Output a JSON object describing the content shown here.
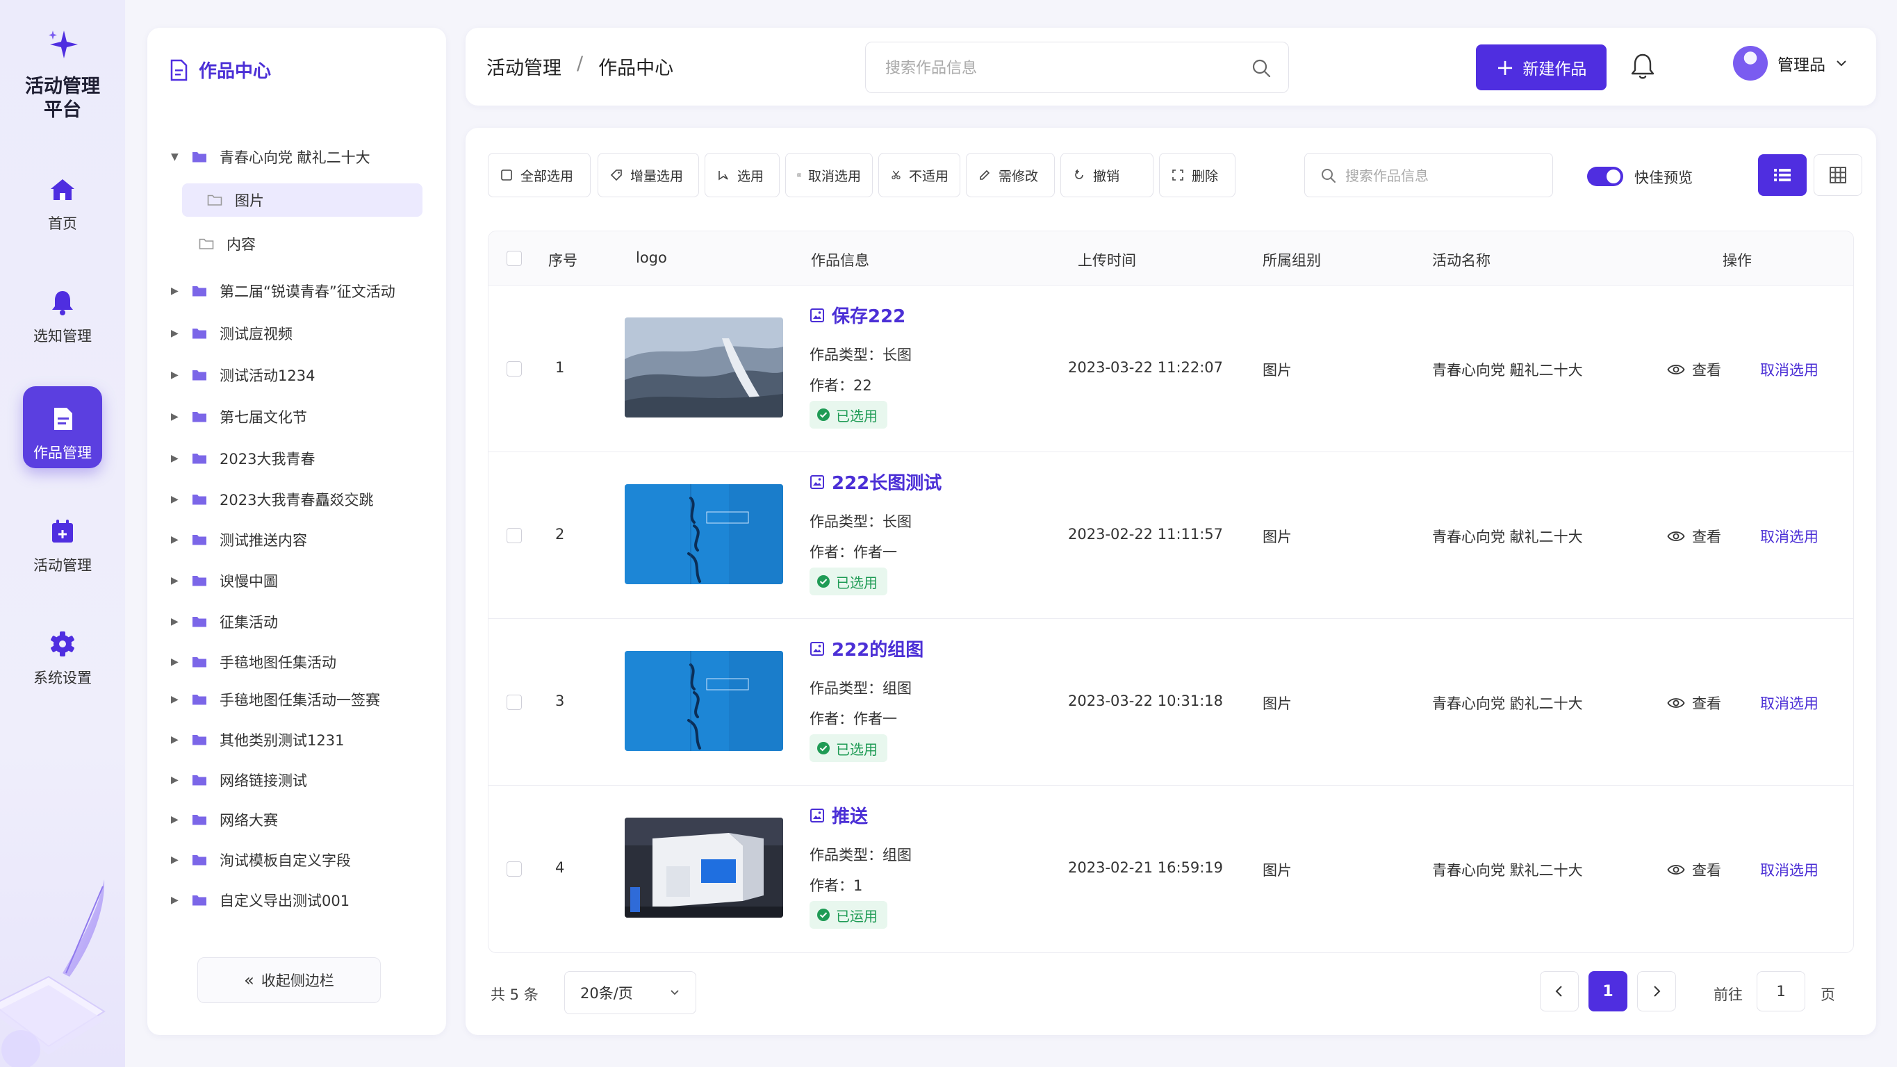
{
  "app": {
    "title": "活动管理\n平台"
  },
  "colors": {
    "primary": "#4f2ee0",
    "selected_green": "#1f9b55",
    "link": "#4b2fd6"
  },
  "nav": {
    "items": [
      {
        "label": "首页",
        "icon": "home-icon"
      },
      {
        "label": "选知管理",
        "icon": "bell-icon"
      },
      {
        "label": "作品管理",
        "icon": "document-icon",
        "active": true
      },
      {
        "label": "活动管理",
        "icon": "calendar-icon"
      },
      {
        "label": "系统设置",
        "icon": "gear-icon"
      }
    ]
  },
  "tree": {
    "title": "作品中心",
    "items": [
      {
        "label": "青春心向党 献礼二十大",
        "expanded": true
      },
      {
        "label": "图片",
        "child": true,
        "selected": true
      },
      {
        "label": "内容",
        "child": true
      },
      {
        "label": "第二届“锐谟青春”征文活动"
      },
      {
        "label": "测试㢄视频"
      },
      {
        "label": "测试活动1234"
      },
      {
        "label": "第七届文化节"
      },
      {
        "label": "2023大我青春"
      },
      {
        "label": "2023大我青春矗㸚交跳"
      },
      {
        "label": "测试推送内容"
      },
      {
        "label": "谀慢中圖"
      },
      {
        "label": "征集活动"
      },
      {
        "label": "手毰地图任集活动"
      },
      {
        "label": "手毰地图任集活动一签赛"
      },
      {
        "label": "其他类别测试1231"
      },
      {
        "label": "网络链接测试"
      },
      {
        "label": "网络大赛"
      },
      {
        "label": "洵试模板自定义字段"
      },
      {
        "label": "自定义导出测试001"
      }
    ],
    "collapse_label": "收起侧边栏"
  },
  "header": {
    "breadcrumb": [
      "活动管理",
      "作品中心"
    ],
    "breadcrumb_sep": "/",
    "search_placeholder": "搜索作品信息",
    "new_button": "新建作品",
    "user_name": "管理品"
  },
  "toolbar": {
    "buttons": [
      {
        "label": "全部选用",
        "icon": "checkbox-icon"
      },
      {
        "label": "增量选用",
        "icon": "tag-icon"
      },
      {
        "label": "选用",
        "icon": "select-icon"
      },
      {
        "label": "取消选用",
        "icon": "cancel-box-icon"
      },
      {
        "label": "不适用",
        "icon": "scissors-icon"
      },
      {
        "label": "需修改",
        "icon": "edit-icon"
      },
      {
        "label": "撤销",
        "icon": "undo-icon"
      },
      {
        "label": "删除",
        "icon": "delete-icon"
      }
    ],
    "search_placeholder": "搜索作品信息",
    "quick_preview_label": "快佳预览",
    "quick_preview_on": true
  },
  "table": {
    "columns": [
      "序号",
      "logo",
      "作品信息",
      "上传时间",
      "所属组别",
      "活动名称",
      "操作"
    ],
    "type_prefix": "作品类型：",
    "author_prefix": "作者：",
    "view_label": "查看",
    "unselect_label": "取消选用",
    "rows": [
      {
        "index": "1",
        "title": "保存222",
        "type": "长图",
        "author": "22",
        "status": "已选用",
        "time": "2023-03-22 11:22:07",
        "group": "图片",
        "activity": "青春心向党 䶊礼二十大",
        "thumb": "great-wall-photo"
      },
      {
        "index": "2",
        "title": "222长图测试",
        "type": "长图",
        "author": "作者一",
        "status": "已选用",
        "time": "2023-02-22 11:11:57",
        "group": "图片",
        "activity": "青春心向党 献礼二十大",
        "thumb": "blue-calligraphy-poster"
      },
      {
        "index": "3",
        "title": "222的组图",
        "type": "组图",
        "author": "作者一",
        "status": "已选用",
        "time": "2023-03-22 10:31:18",
        "group": "图片",
        "activity": "青春心向党 䶂礼二十大",
        "thumb": "blue-calligraphy-poster"
      },
      {
        "index": "4",
        "title": "推送",
        "type": "组图",
        "author": "1",
        "status": "已运用",
        "time": "2023-02-21 16:59:19",
        "group": "图片",
        "activity": "青春心向党 默礼二十大",
        "thumb": "exhibition-booth-photo"
      }
    ]
  },
  "pagination": {
    "total_label": "共 5 条",
    "page_size": "20条/页",
    "current_page": "1",
    "goto_prefix": "前往",
    "goto_value": "1",
    "goto_suffix": "页"
  }
}
